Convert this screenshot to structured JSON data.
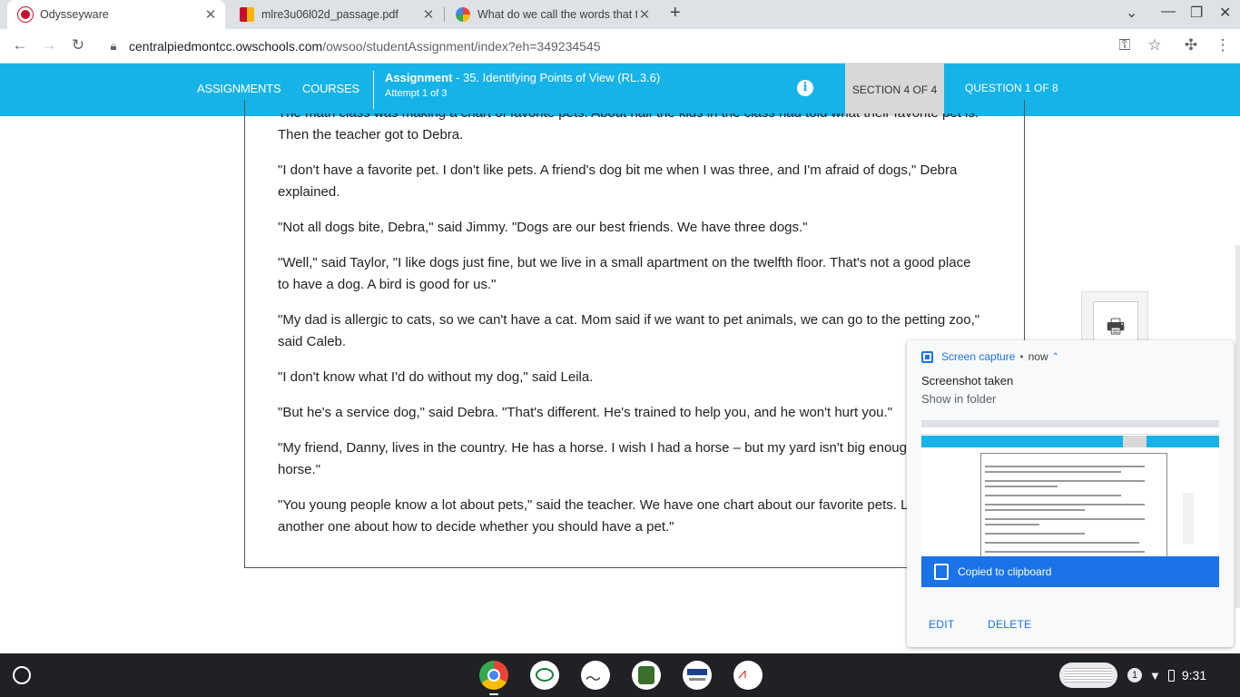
{
  "tabs": [
    {
      "title": "Odysseyware",
      "active": true
    },
    {
      "title": "mlre3u06l02d_passage.pdf",
      "active": false
    },
    {
      "title": "What do we call the words that t",
      "active": false
    }
  ],
  "address_bar": {
    "host": "centralpiedmontcc.owschools.com",
    "path": "/owsoo/studentAssignment/index?eh=349234545"
  },
  "appbar": {
    "assignments": "ASSIGNMENTS",
    "courses": "COURSES",
    "assignment_label": "Assignment",
    "assignment_title": " - 35. Identifying Points of View (RL.3.6)",
    "attempt": "Attempt 1 of 3",
    "info": "i",
    "section": "SECTION 4 OF 4",
    "question": "QUESTION 1 OF 8"
  },
  "passage": [
    "The math class was making a chart of favorite pets. About half the kids in the class had told what their favorite pet is. Then the teacher got to Debra.",
    "\"I don't have a favorite pet. I don't like pets. A friend's dog bit me when I was three, and I'm afraid of dogs,\" Debra explained.",
    "\"Not all dogs bite, Debra,\" said Jimmy. \"Dogs are our best friends. We have three dogs.\"",
    "\"Well,\" said Taylor, \"I like dogs just fine, but we live in a small apartment on the twelfth floor. That's not a good place to have a dog. A bird is good for us.\"",
    "\"My dad is allergic to cats, so we can't have a cat. Mom said if we want to pet animals, we can go to the petting zoo,\" said Caleb.",
    "\"I don't know what I'd do without my dog,\" said Leila.",
    "\"But he's a service dog,\" said Debra. \"That's different. He's trained to help you, and he won't hurt you.\"",
    "\"My friend, Danny, lives in the country. He has a horse. I wish I had a horse – but my yard isn't big enough for a horse.\"",
    "\"You young people know a lot about pets,\" said the teacher. We have one chart about our favorite pets. Let's start another one about how to decide whether you should have a pet.\""
  ],
  "notification": {
    "source": "Screen capture",
    "time": "now",
    "title": "Screenshot taken",
    "subtitle": "Show in folder",
    "clipboard": "Copied to clipboard",
    "edit": "EDIT",
    "delete": "DELETE"
  },
  "tray": {
    "badge": "1",
    "time": "9:31"
  },
  "colors": {
    "accent": "#16b3e8",
    "chrome_blue": "#1a73e8",
    "shelf": "#202124"
  }
}
